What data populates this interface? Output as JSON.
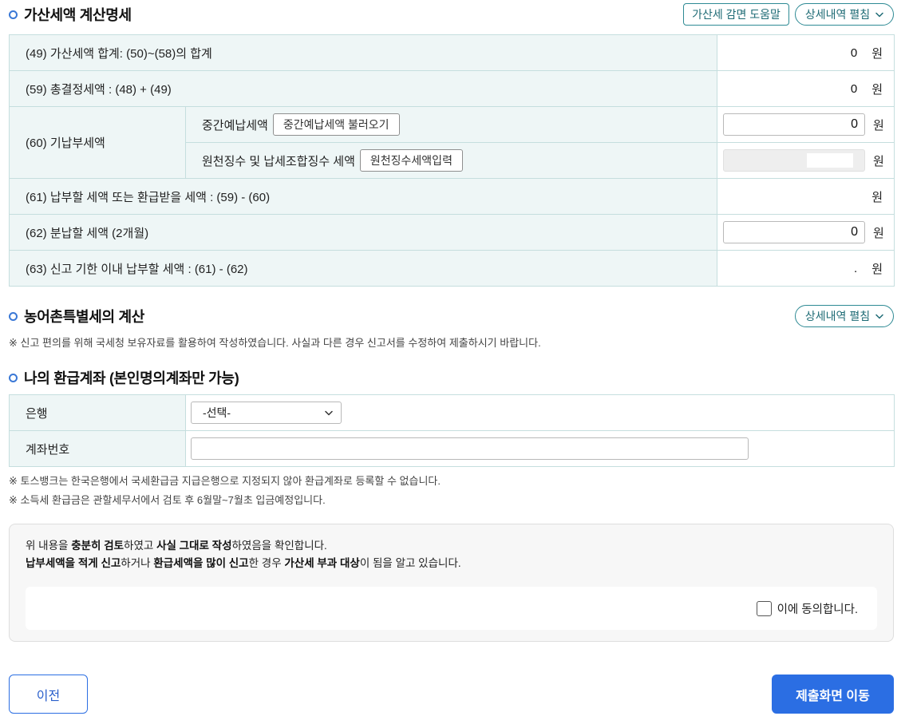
{
  "colors": {
    "accent_blue": "#2b6ee3",
    "teal": "#2e8a94",
    "teal_text": "#1e6b75",
    "label_bg": "#eef6f6",
    "table_border": "#c5dede",
    "confirm_bg": "#f7f7f7",
    "bullet_blue": "#3a78d6"
  },
  "icons": {
    "section_bullet": "bullet-circle-icon",
    "expand": "chevron-down-icon",
    "select": "chevron-down-icon"
  },
  "penalty_section": {
    "title": "가산세액 계산명세",
    "help_button": "가산세 감면 도움말",
    "expand_button": "상세내역 펼침",
    "rows": [
      {
        "label": "(49) 가산세액 합계: (50)~(58)의 합계",
        "value": "0",
        "unit": "원"
      },
      {
        "label": "(59) 총결정세액 : (48) + (49)",
        "value": "0",
        "unit": "원"
      },
      {
        "label": "(60) 기납부세액",
        "sub_rows": [
          {
            "label": "중간예납세액",
            "button": "중간예납세액 불러오기",
            "value": "0",
            "unit": "원"
          },
          {
            "label": "원천징수 및 납세조합징수 세액",
            "button": "원천징수세액입력",
            "value": "",
            "unit": "원"
          }
        ]
      },
      {
        "label": "(61) 납부할 세액 또는 환급받을 세액 : (59) - (60)",
        "value": "",
        "unit": "원"
      },
      {
        "label": "(62) 분납할 세액 (2개월)",
        "value": "0",
        "unit": "원"
      },
      {
        "label": "(63) 신고 기한 이내 납부할 세액 : (61) - (62)",
        "value": ".",
        "unit": "원"
      }
    ]
  },
  "rural_section": {
    "title": "농어촌특별세의 계산",
    "expand_button": "상세내역 펼침",
    "note": "※ 신고 편의를 위해 국세청 보유자료를 활용하여 작성하였습니다. 사실과 다른 경우 신고서를 수정하여 제출하시기 바랍니다."
  },
  "refund_section": {
    "title": "나의 환급계좌 (본인명의계좌만 가능)",
    "bank_label": "은행",
    "bank_selected": "-선택-",
    "account_label": "계좌번호",
    "account_value": "",
    "notes": [
      "※ 토스뱅크는 한국은행에서 국세환급금 지급은행으로 지정되지 않아 환급계좌로 등록할 수 없습니다.",
      "※ 소득세 환급금은 관할세무서에서 검토 후 6월말~7월초 입금예정입니다."
    ]
  },
  "confirm": {
    "line1": [
      "위 내용을 ",
      "충분히 검토",
      "하였고 ",
      "사실 그대로 작성",
      "하였음을 확인합니다."
    ],
    "line2": [
      "납부세액을 적게 신고",
      "하거나 ",
      "환급세액을 많이 신고",
      "한 경우 ",
      "가산세 부과 대상",
      "이 됨을 알고 있습니다."
    ],
    "agree_label": "이에 동의합니다.",
    "agree_checked": false
  },
  "footer": {
    "prev_button": "이전",
    "next_button": "제출화면 이동"
  }
}
